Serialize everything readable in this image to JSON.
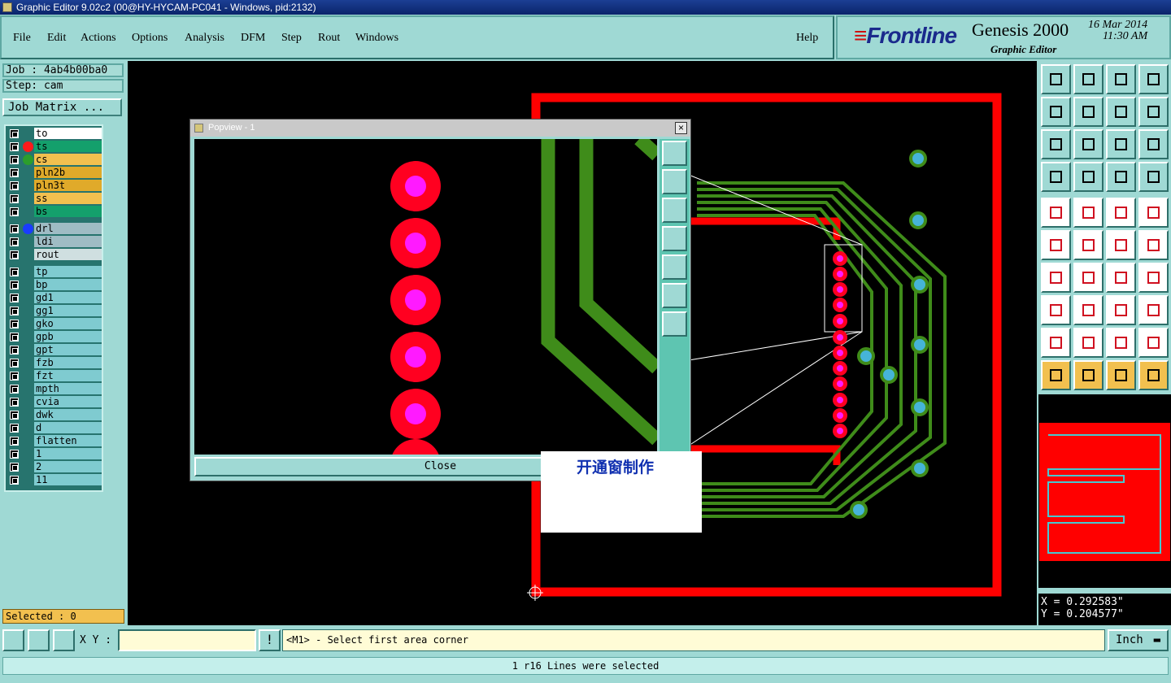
{
  "window": {
    "title": "Graphic Editor 9.02c2 (00@HY-HYCAM-PC041 - Windows, pid:2132)"
  },
  "menu": [
    "File",
    "Edit",
    "Actions",
    "Options",
    "Analysis",
    "DFM",
    "Step",
    "Rout",
    "Windows"
  ],
  "help": "Help",
  "brand": {
    "logo": "Frontline",
    "product": "Genesis 2000",
    "subtitle": "Graphic Editor",
    "date": "16 Mar 2014",
    "time": "11:30 AM"
  },
  "job": {
    "job": "Job : 4ab4b00ba0",
    "step": "Step: cam",
    "matrix_button": "Job Matrix ..."
  },
  "layers": [
    {
      "name": "to",
      "color": "#ffffff",
      "dot": ""
    },
    {
      "name": "ts",
      "color": "#14a06c",
      "dot": "#ff1a1a"
    },
    {
      "name": "cs",
      "color": "#f2c04f",
      "dot": "#2c9e2c"
    },
    {
      "name": "pln2b",
      "color": "#e0aa2a",
      "dot": ""
    },
    {
      "name": "pln3t",
      "color": "#e0aa2a",
      "dot": ""
    },
    {
      "name": "ss",
      "color": "#f2c04f",
      "dot": ""
    },
    {
      "name": "bs",
      "color": "#14a06c",
      "dot": ""
    },
    {
      "name": "drl",
      "color": "#9fbcc4",
      "dot": "#1a3cff"
    },
    {
      "name": "ldi",
      "color": "#9fbcc4",
      "dot": ""
    },
    {
      "name": "rout",
      "color": "#cfdfe0",
      "dot": ""
    },
    {
      "name": "tp",
      "color": "#7fcbd0",
      "dot": ""
    },
    {
      "name": "bp",
      "color": "#7fcbd0",
      "dot": ""
    },
    {
      "name": "gd1",
      "color": "#7fcbd0",
      "dot": ""
    },
    {
      "name": "gg1",
      "color": "#7fcbd0",
      "dot": ""
    },
    {
      "name": "gko",
      "color": "#7fcbd0",
      "dot": ""
    },
    {
      "name": "gpb",
      "color": "#7fcbd0",
      "dot": ""
    },
    {
      "name": "gpt",
      "color": "#7fcbd0",
      "dot": ""
    },
    {
      "name": "fzb",
      "color": "#7fcbd0",
      "dot": ""
    },
    {
      "name": "fzt",
      "color": "#7fcbd0",
      "dot": ""
    },
    {
      "name": "mpth",
      "color": "#7fcbd0",
      "dot": ""
    },
    {
      "name": "cvia",
      "color": "#7fcbd0",
      "dot": ""
    },
    {
      "name": "dwk",
      "color": "#7fcbd0",
      "dot": ""
    },
    {
      "name": "d",
      "color": "#7fcbd0",
      "dot": ""
    },
    {
      "name": "flatten",
      "color": "#7fcbd0",
      "dot": ""
    },
    {
      "name": "1",
      "color": "#7fcbd0",
      "dot": ""
    },
    {
      "name": "2",
      "color": "#7fcbd0",
      "dot": ""
    },
    {
      "name": "11",
      "color": "#7fcbd0",
      "dot": ""
    }
  ],
  "selected": "Selected : 0",
  "popview": {
    "title": "Popview - 1",
    "close": "Close"
  },
  "annotation": "开通窗制作",
  "coords": {
    "x": "X = 0.292583\"",
    "y": "Y = 0.204577\""
  },
  "cmd": {
    "xy_label": "X Y :",
    "xy_value": "",
    "prompt": "<M1> - Select first area corner",
    "units": "Inch"
  },
  "status": "1 r16 Lines were selected",
  "colors": {
    "pad": "#ff0020",
    "hole": "#ff1aff",
    "trace": "#3f8c1a",
    "via": "#46b4d8",
    "board": "#ff0000"
  }
}
